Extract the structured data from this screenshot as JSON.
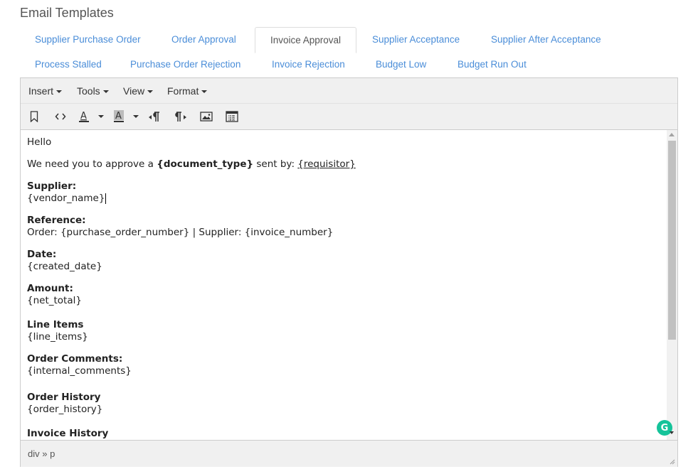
{
  "page": {
    "title": "Email Templates"
  },
  "tabs": [
    {
      "label": "Supplier Purchase Order"
    },
    {
      "label": "Order Approval"
    },
    {
      "label": "Invoice Approval",
      "active": true
    },
    {
      "label": "Supplier Acceptance"
    },
    {
      "label": "Supplier After Acceptance"
    },
    {
      "label": "Process Stalled"
    },
    {
      "label": "Purchase Order Rejection"
    },
    {
      "label": "Invoice Rejection"
    },
    {
      "label": "Budget Low"
    },
    {
      "label": "Budget Run Out"
    }
  ],
  "menubar": {
    "insert": "Insert",
    "tools": "Tools",
    "view": "View",
    "format": "Format"
  },
  "toolbar_icons": [
    "bookmark-icon",
    "source-code-icon",
    "text-color-icon",
    "background-color-icon",
    "ltr-icon",
    "rtl-icon",
    "image-icon",
    "template-icon"
  ],
  "content": {
    "greeting": "Hello",
    "intro_prefix": "We need you to approve a ",
    "intro_doc_type": "{document_type}",
    "intro_middle": " sent by: ",
    "intro_requisitor": "{requisitor}",
    "supplier_label": "Supplier:",
    "supplier_value": "{vendor_name}",
    "reference_label": "Reference:",
    "reference_value": "Order: {purchase_order_number} | Supplier: {invoice_number}",
    "date_label": "Date:",
    "date_value": "{created_date}",
    "amount_label": "Amount:",
    "amount_value": "{net_total}",
    "line_items_label": "Line Items",
    "line_items_value": "{line_items}",
    "order_comments_label": "Order Comments:",
    "order_comments_value": "{internal_comments}",
    "order_history_label": "Order History",
    "order_history_value": "{order_history}",
    "invoice_history_label": "Invoice History"
  },
  "statusbar": {
    "path": "div » p"
  },
  "colors": {
    "tab_link": "#4a8dd8",
    "grammarly": "#15c39a"
  }
}
